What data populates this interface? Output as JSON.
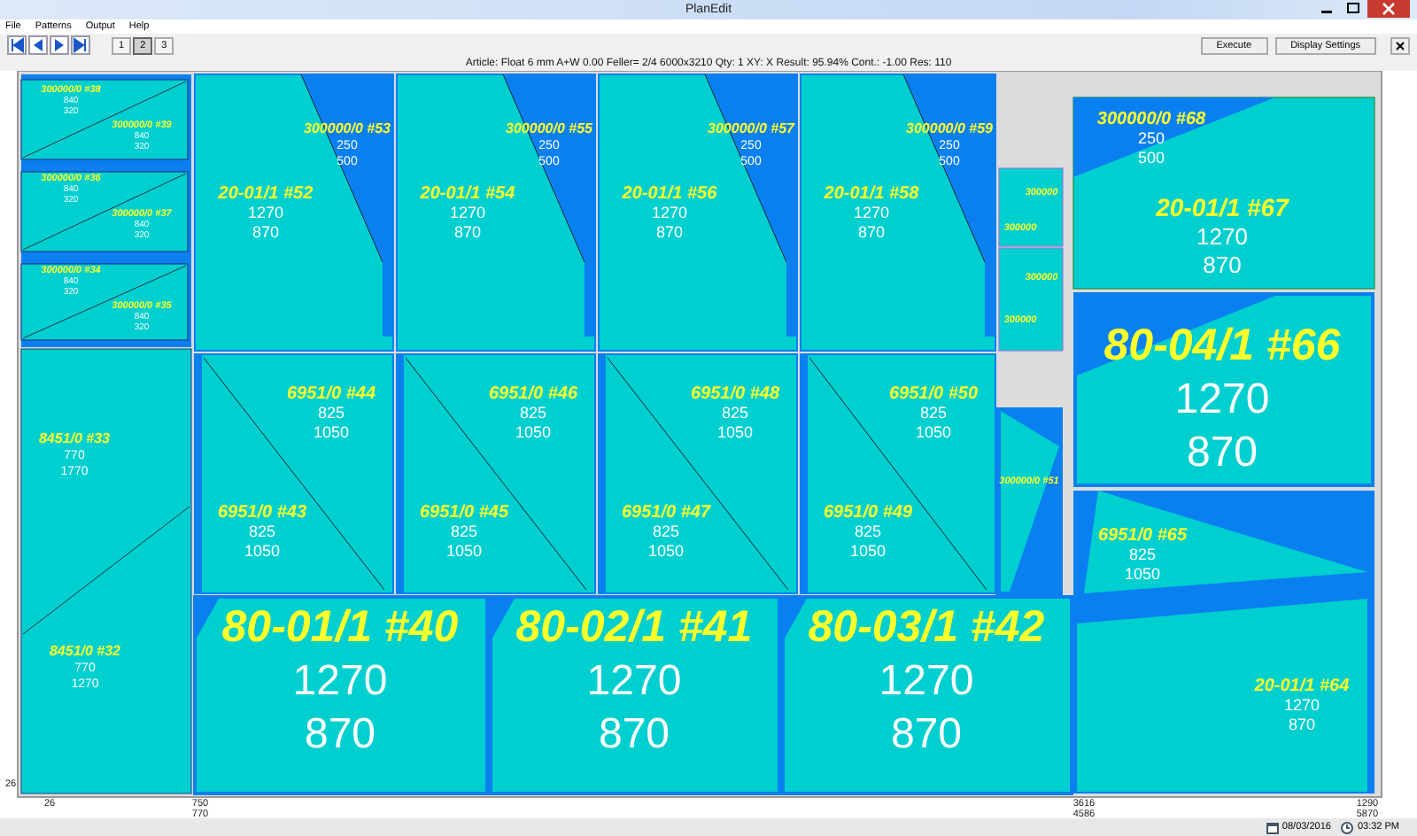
{
  "window": {
    "title": "PlanEdit"
  },
  "menu": [
    {
      "label": "File"
    },
    {
      "label": "Patterns"
    },
    {
      "label": "Output"
    },
    {
      "label": "Help"
    }
  ],
  "toolbar": {
    "pages": [
      {
        "label": "1",
        "selected": false
      },
      {
        "label": "2",
        "selected": true
      },
      {
        "label": "3",
        "selected": false
      }
    ],
    "buttons": [
      "Execute",
      "Display Settings"
    ]
  },
  "info": "Article: Float 6 mm  A+W 0.00  Feller= 2/4  6000x3210  Qty: 1  XY: X  Result: 95.94%  Cont.: -1.00  Res: 110",
  "plan": {
    "pieces": [
      {
        "label": "300000/0 #38",
        "dims": [
          "840",
          "320"
        ]
      },
      {
        "label": "300000/0 #39",
        "dims": [
          "840",
          "320"
        ]
      },
      {
        "label": "300000/0 #36",
        "dims": [
          "840",
          "320"
        ]
      },
      {
        "label": "300000/0 #37",
        "dims": [
          "840",
          "320"
        ]
      },
      {
        "label": "300000/0 #34",
        "dims": [
          "840",
          "320"
        ]
      },
      {
        "label": "300000/0 #35",
        "dims": [
          "840",
          "320"
        ]
      },
      {
        "label": "8451/0 #33",
        "dims": [
          "770",
          "1770"
        ]
      },
      {
        "label": "8451/0 #32",
        "dims": [
          "770",
          "1270"
        ]
      },
      {
        "label": "20-01/1 #52",
        "dims": [
          "1270",
          "870"
        ]
      },
      {
        "label": "300000/0 #53",
        "dims": [
          "250",
          "500"
        ]
      },
      {
        "label": "20-01/1 #54",
        "dims": [
          "1270",
          "870"
        ]
      },
      {
        "label": "300000/0 #55",
        "dims": [
          "250",
          "500"
        ]
      },
      {
        "label": "20-01/1 #56",
        "dims": [
          "1270",
          "870"
        ]
      },
      {
        "label": "300000/0 #57",
        "dims": [
          "250",
          "500"
        ]
      },
      {
        "label": "20-01/1 #58",
        "dims": [
          "1270",
          "870"
        ]
      },
      {
        "label": "300000/0 #59",
        "dims": [
          "250",
          "500"
        ]
      },
      {
        "label": "300000"
      },
      {
        "label": "300000"
      },
      {
        "label": "300000"
      },
      {
        "label": "300000"
      },
      {
        "label": "300000/0 #51"
      },
      {
        "label": "6951/0 #44",
        "dims": [
          "825",
          "1050"
        ]
      },
      {
        "label": "6951/0 #43",
        "dims": [
          "825",
          "1050"
        ]
      },
      {
        "label": "6951/0 #46",
        "dims": [
          "825",
          "1050"
        ]
      },
      {
        "label": "6951/0 #45",
        "dims": [
          "825",
          "1050"
        ]
      },
      {
        "label": "6951/0 #48",
        "dims": [
          "825",
          "1050"
        ]
      },
      {
        "label": "6951/0 #47",
        "dims": [
          "825",
          "1050"
        ]
      },
      {
        "label": "6951/0 #50",
        "dims": [
          "825",
          "1050"
        ]
      },
      {
        "label": "6951/0 #49",
        "dims": [
          "825",
          "1050"
        ]
      },
      {
        "label": "80-01/1 #40",
        "dims": [
          "1270",
          "870"
        ]
      },
      {
        "label": "80-02/1 #41",
        "dims": [
          "1270",
          "870"
        ]
      },
      {
        "label": "80-03/1 #42",
        "dims": [
          "1270",
          "870"
        ]
      },
      {
        "label": "300000/0 #68",
        "dims": [
          "250",
          "500"
        ]
      },
      {
        "label": "20-01/1 #67",
        "dims": [
          "1270",
          "870"
        ]
      },
      {
        "label": "80-04/1 #66",
        "dims": [
          "1270",
          "870"
        ]
      },
      {
        "label": "6951/0 #65",
        "dims": [
          "825",
          "1050"
        ]
      },
      {
        "label": "20-01/1 #64",
        "dims": [
          "1270",
          "870"
        ]
      }
    ],
    "axis": [
      "26",
      "26",
      "750",
      "770",
      "3616",
      "4586",
      "1290",
      "5870"
    ]
  },
  "status_bar": {
    "date": "08/03/2016",
    "time": "03:32 PM"
  }
}
